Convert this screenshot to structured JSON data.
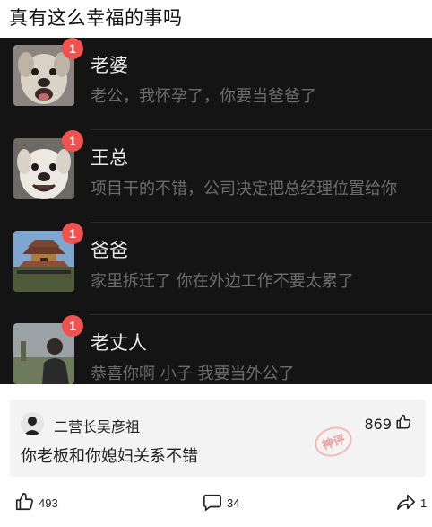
{
  "post": {
    "title": "真有这么幸福的事吗"
  },
  "chats": [
    {
      "name": "老婆",
      "message": "老公，我怀孕了，你要当爸爸了",
      "unread": "1",
      "avatar_icon": "dog-face-icon"
    },
    {
      "name": "王总",
      "message": "项目干的不错，公司决定把总经理位置给你",
      "unread": "1",
      "avatar_icon": "dog-face-icon"
    },
    {
      "name": "爸爸",
      "message": "家里拆迁了 你在外边工作不要太累了",
      "unread": "1",
      "avatar_icon": "pavilion-icon"
    },
    {
      "name": "老丈人",
      "message": "恭喜你啊 小子 我要当外公了",
      "unread": "1",
      "avatar_icon": "man-portrait-icon"
    }
  ],
  "comment": {
    "username": "二营长吴彦祖",
    "likes": "869",
    "text": "你老板和你媳妇关系不错",
    "stamp": "神评"
  },
  "actions": {
    "like_count": "493",
    "comment_count": "34",
    "share_count": "1"
  },
  "colors": {
    "chat_background": "#141414",
    "badge": "#f0524f",
    "stamp": "#f4a3a3"
  }
}
